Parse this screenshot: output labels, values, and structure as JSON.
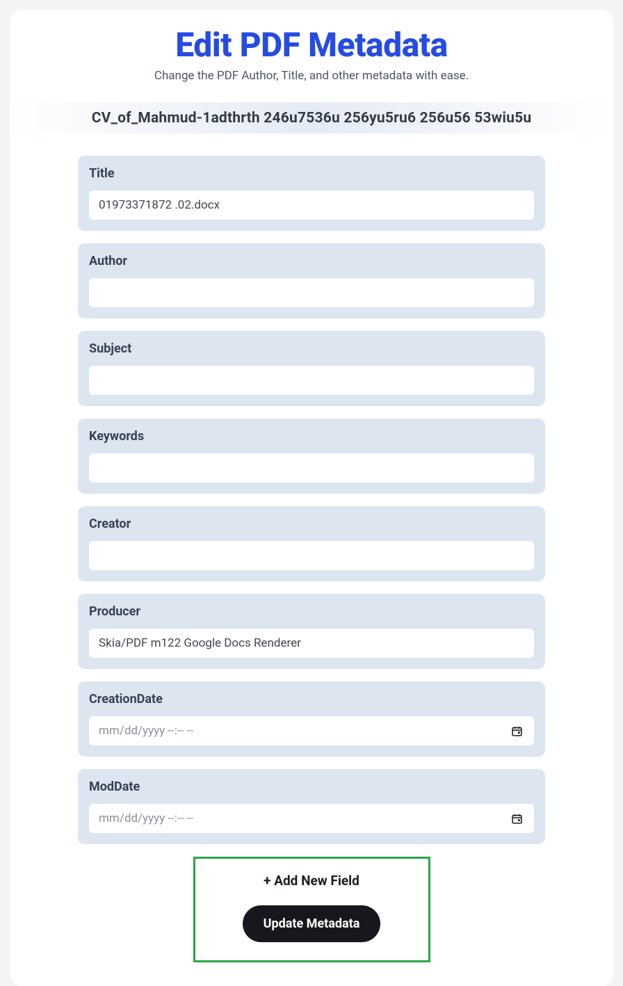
{
  "header": {
    "title": "Edit PDF Metadata",
    "subtitle": "Change the PDF Author, Title, and other metadata with ease."
  },
  "filename": "CV_of_Mahmud-1adthrth 246u7536u 256yu5ru6 256u56 53wiu5u",
  "fields": {
    "title": {
      "label": "Title",
      "value": "01973371872 .02.docx"
    },
    "author": {
      "label": "Author",
      "value": ""
    },
    "subject": {
      "label": "Subject",
      "value": ""
    },
    "keywords": {
      "label": "Keywords",
      "value": ""
    },
    "creator": {
      "label": "Creator",
      "value": ""
    },
    "producer": {
      "label": "Producer",
      "value": "Skia/PDF m122 Google Docs Renderer"
    },
    "creation_date": {
      "label": "CreationDate",
      "placeholder": "mm/dd/yyyy --:-- --"
    },
    "mod_date": {
      "label": "ModDate",
      "placeholder": "mm/dd/yyyy --:-- --"
    }
  },
  "actions": {
    "add_field": "+ Add New Field",
    "update": "Update Metadata"
  }
}
